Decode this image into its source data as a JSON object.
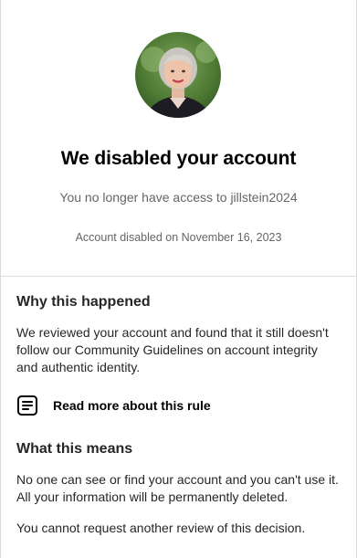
{
  "header": {
    "avatar_icon": "profile-photo",
    "title": "We disabled your account",
    "subtitle": "You no longer have access to jillstein2024",
    "disabled_date": "Account disabled on November 16, 2023"
  },
  "why": {
    "heading": "Why this happened",
    "body": "We reviewed your account and found that it still doesn't follow our Community Guidelines on account integrity and authentic identity.",
    "rule_link_label": "Read more about this rule",
    "rule_icon": "document-icon"
  },
  "means": {
    "heading": "What this means",
    "body1": "No one can see or find your account and you can't use it. All your information will be permanently deleted.",
    "body2": "You cannot request another review of this decision."
  },
  "colors": {
    "border": "#dbdbdb",
    "muted_text": "#666666",
    "body_text": "#262626"
  }
}
